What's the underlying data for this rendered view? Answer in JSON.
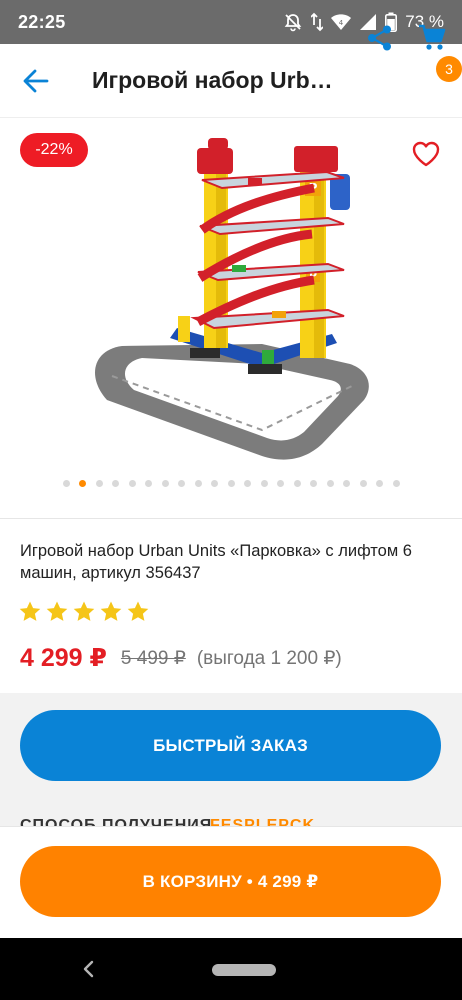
{
  "status_bar": {
    "time": "22:25",
    "battery": "73 %",
    "icons": [
      "mute-icon",
      "data-arrows-icon",
      "wifi-icon",
      "cellular-signal-icon",
      "battery-icon"
    ]
  },
  "app_bar": {
    "title": "Игровой набор Urban Units «Парковка» с лифтом 6 машин, артикул 356437",
    "cart_count": "3",
    "icons": [
      "arrow-back-icon",
      "share-icon",
      "cart-icon"
    ]
  },
  "gallery": {
    "discount": "-22%",
    "image": "multi-level parking garage toy set with red ramps, yellow pillars and grey road track",
    "dots_total": 21,
    "dots_active": 1
  },
  "product": {
    "title": "Игровой набор Urban Units «Парковка» с лифтом 6 машин, артикул 356437",
    "rating": 5,
    "rating_max": 5,
    "price_current": "4 299 ₽",
    "price_old": "5 499 ₽",
    "price_saving": "(выгода 1 200 ₽)"
  },
  "actions": {
    "quick_order": "БЫСТРЫЙ ЗАКАЗ",
    "add_to_cart": "В КОРЗИНУ • 4 299 ₽"
  },
  "delivery": {
    "label": "СПОСОБ ПОЛУЧЕНИЯ",
    "value": "FESPLEPCK"
  },
  "colors": {
    "accent_blue": "#0a83d6",
    "accent_orange": "#ff8200",
    "price_red": "#e31e24",
    "star": "#f5c518"
  }
}
